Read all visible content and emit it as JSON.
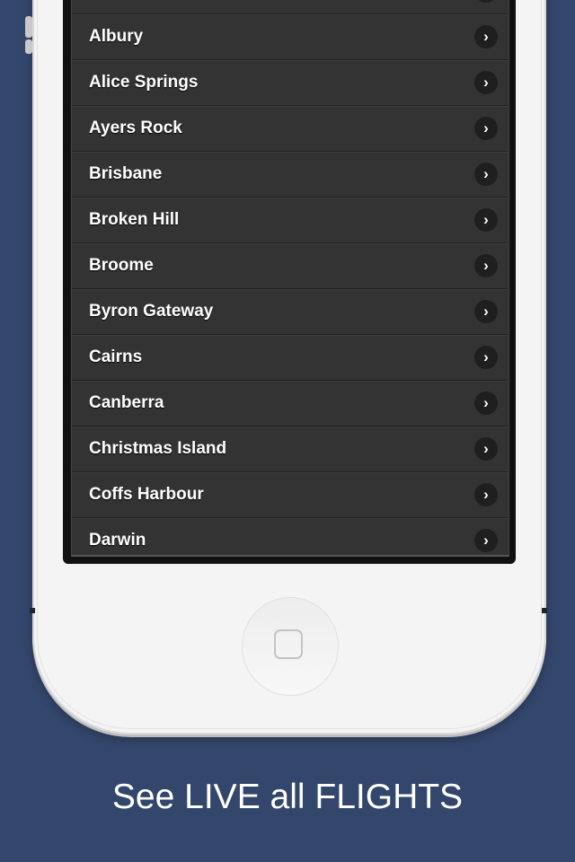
{
  "list": {
    "items": [
      {
        "label": ""
      },
      {
        "label": "Albury"
      },
      {
        "label": "Alice Springs"
      },
      {
        "label": "Ayers Rock"
      },
      {
        "label": "Brisbane"
      },
      {
        "label": "Broken Hill"
      },
      {
        "label": "Broome"
      },
      {
        "label": "Byron Gateway"
      },
      {
        "label": "Cairns"
      },
      {
        "label": "Canberra"
      },
      {
        "label": "Christmas Island"
      },
      {
        "label": "Coffs Harbour"
      },
      {
        "label": "Darwin"
      }
    ],
    "chevron": "›"
  },
  "caption": "See LIVE all FLIGHTS",
  "colors": {
    "background": "#33466b",
    "list_bg": "#333333",
    "phone": "#f4f4f4"
  }
}
